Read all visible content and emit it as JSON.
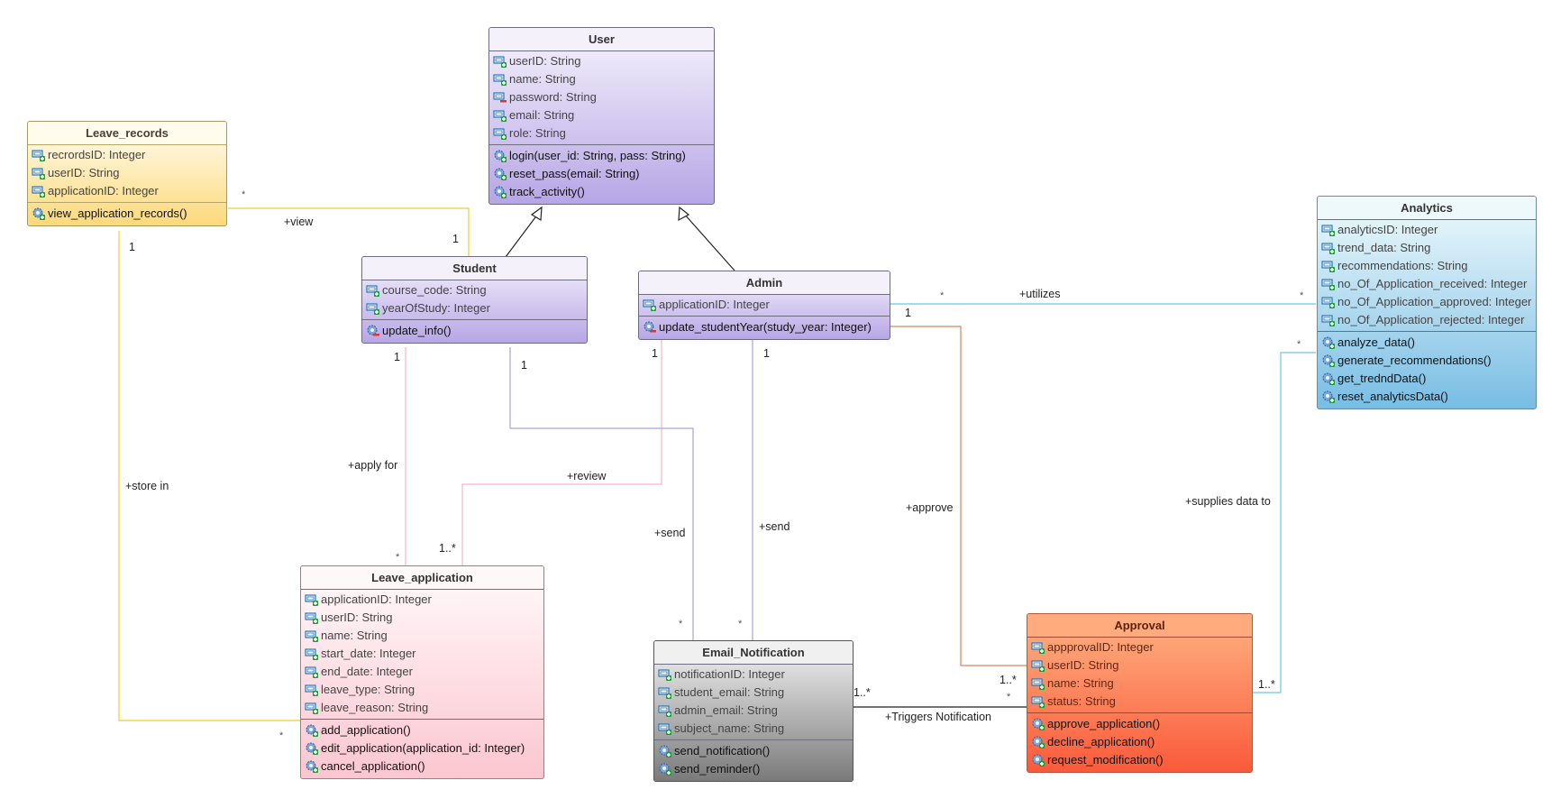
{
  "classes": {
    "user": {
      "name": "User",
      "attributes": [
        {
          "text": "userID: String",
          "visibility": "public"
        },
        {
          "text": "name: String",
          "visibility": "public"
        },
        {
          "text": "password: String",
          "visibility": "private"
        },
        {
          "text": "email: String",
          "visibility": "public"
        },
        {
          "text": "role: String",
          "visibility": "public"
        }
      ],
      "operations": [
        {
          "text": "login(user_id: String, pass: String)",
          "visibility": "public"
        },
        {
          "text": "reset_pass(email: String)",
          "visibility": "public"
        },
        {
          "text": "track_activity()",
          "visibility": "public"
        }
      ]
    },
    "leave_records": {
      "name": "Leave_records",
      "attributes": [
        {
          "text": "recrordsID: Integer",
          "visibility": "public"
        },
        {
          "text": "userID: String",
          "visibility": "public"
        },
        {
          "text": "applicationID: Integer",
          "visibility": "public"
        }
      ],
      "operations": [
        {
          "text": "view_application_records()",
          "visibility": "public"
        }
      ]
    },
    "student": {
      "name": "Student",
      "attributes": [
        {
          "text": "course_code: String",
          "visibility": "public"
        },
        {
          "text": "yearOfStudy: Integer",
          "visibility": "public"
        }
      ],
      "operations": [
        {
          "text": "update_info()",
          "visibility": "private"
        }
      ]
    },
    "admin": {
      "name": "Admin",
      "attributes": [
        {
          "text": "applicationID: Integer",
          "visibility": "public"
        }
      ],
      "operations": [
        {
          "text": "update_studentYear(study_year: Integer)",
          "visibility": "private"
        }
      ]
    },
    "analytics": {
      "name": "Analytics",
      "attributes": [
        {
          "text": "analyticsID: Integer",
          "visibility": "public"
        },
        {
          "text": "trend_data: String",
          "visibility": "public"
        },
        {
          "text": "recommendations: String",
          "visibility": "public"
        },
        {
          "text": "no_Of_Application_received: Integer",
          "visibility": "public"
        },
        {
          "text": "no_Of_Application_approved: Integer",
          "visibility": "public"
        },
        {
          "text": "no_Of_Application_rejected: Integer",
          "visibility": "public"
        }
      ],
      "operations": [
        {
          "text": "analyze_data()",
          "visibility": "public"
        },
        {
          "text": "generate_recommendations()",
          "visibility": "public"
        },
        {
          "text": "get_tredndData()",
          "visibility": "public"
        },
        {
          "text": "reset_analyticsData()",
          "visibility": "public"
        }
      ]
    },
    "leave_application": {
      "name": "Leave_application",
      "attributes": [
        {
          "text": "applicationID: Integer",
          "visibility": "public"
        },
        {
          "text": "userID: String",
          "visibility": "public"
        },
        {
          "text": "name: String",
          "visibility": "public"
        },
        {
          "text": "start_date: Integer",
          "visibility": "public"
        },
        {
          "text": "end_date: Integer",
          "visibility": "public"
        },
        {
          "text": "leave_type: String",
          "visibility": "public"
        },
        {
          "text": "leave_reason: String",
          "visibility": "public"
        }
      ],
      "operations": [
        {
          "text": "add_application()",
          "visibility": "public"
        },
        {
          "text": "edit_application(application_id: Integer)",
          "visibility": "public"
        },
        {
          "text": "cancel_application()",
          "visibility": "public"
        }
      ]
    },
    "email_notification": {
      "name": "Email_Notification",
      "attributes": [
        {
          "text": "notificationID: Integer",
          "visibility": "public"
        },
        {
          "text": "student_email: String",
          "visibility": "public"
        },
        {
          "text": "admin_email: String",
          "visibility": "public"
        },
        {
          "text": "subject_name: String",
          "visibility": "public"
        }
      ],
      "operations": [
        {
          "text": "send_notification()",
          "visibility": "public"
        },
        {
          "text": "send_reminder()",
          "visibility": "public"
        }
      ]
    },
    "approval": {
      "name": "Approval",
      "attributes": [
        {
          "text": "appprovalID: Integer",
          "visibility": "public"
        },
        {
          "text": "userID: String",
          "visibility": "public"
        },
        {
          "text": "name: String",
          "visibility": "public"
        },
        {
          "text": "status: String",
          "visibility": "public"
        }
      ],
      "operations": [
        {
          "text": "approve_application()",
          "visibility": "public"
        },
        {
          "text": "decline_application()",
          "visibility": "public"
        },
        {
          "text": "request_modification()",
          "visibility": "public"
        }
      ]
    }
  },
  "relationships": [
    {
      "id": "gen-student-user",
      "type": "generalization",
      "from": "Student",
      "to": "User"
    },
    {
      "id": "gen-admin-user",
      "type": "generalization",
      "from": "Admin",
      "to": "User"
    },
    {
      "id": "assoc-view",
      "type": "association",
      "label": "+view",
      "from": "Leave_records",
      "to": "Student",
      "mult_from": "*",
      "mult_to": "1",
      "color": "#f0d020"
    },
    {
      "id": "assoc-store",
      "type": "association",
      "label": "+store in",
      "from": "Leave_records",
      "to": "Leave_application",
      "mult_from": "1",
      "mult_to": "*",
      "color": "#f0d020"
    },
    {
      "id": "assoc-apply",
      "type": "association",
      "label": "+apply for",
      "from": "Student",
      "to": "Leave_application",
      "mult_from": "1",
      "mult_to": "*",
      "color": "#f2b8c6"
    },
    {
      "id": "assoc-review",
      "type": "association",
      "label": "+review",
      "from": "Admin",
      "to": "Leave_application",
      "mult_from": "1",
      "mult_to": "1..*",
      "color": "#f2b8c6"
    },
    {
      "id": "assoc-send-student",
      "type": "association",
      "label": "+send",
      "from": "Student",
      "to": "Email_Notification",
      "mult_from": "1",
      "mult_to": "*",
      "color": "#a9a3d6"
    },
    {
      "id": "assoc-send-admin",
      "type": "association",
      "label": "+send",
      "from": "Admin",
      "to": "Email_Notification",
      "mult_from": "1",
      "mult_to": "*",
      "color": "#a9a3d6"
    },
    {
      "id": "assoc-utilizes",
      "type": "association",
      "label": "+utilizes",
      "from": "Admin",
      "to": "Analytics",
      "mult_from": "*",
      "mult_to": "*",
      "color": "#6cc6e0"
    },
    {
      "id": "assoc-approve",
      "type": "association",
      "label": "+approve",
      "from": "Admin",
      "to": "Approval",
      "mult_from": "1",
      "mult_to": "1..*",
      "color": "#e0805a"
    },
    {
      "id": "assoc-supplies",
      "type": "association",
      "label": "+supplies data to",
      "from": "Approval",
      "to": "Analytics",
      "mult_from": "1..*",
      "mult_to": "*",
      "color": "#6cc6e0"
    },
    {
      "id": "assoc-triggers",
      "type": "association",
      "label": "+Triggers Notification",
      "from": "Email_Notification",
      "to": "Approval",
      "mult_from": "1..*",
      "mult_to": "*",
      "color": "#222222"
    }
  ],
  "labels": {
    "view": "+view",
    "store_in": "+store in",
    "apply_for": "+apply for",
    "review": "+review",
    "send_student": "+send",
    "send_admin": "+send",
    "utilizes": "+utilizes",
    "approve": "+approve",
    "supplies": "+supplies data to",
    "triggers": "+Triggers Notification"
  },
  "multiplicities": {
    "view_records": "*",
    "view_student": "1",
    "store_records": "1",
    "store_app": "*",
    "apply_student": "1",
    "apply_app": "*",
    "review_admin": "1",
    "review_app": "1..*",
    "send_student": "1",
    "send_student_email": "*",
    "send_admin": "1",
    "send_admin_email": "*",
    "utilizes_admin": "*",
    "utilizes_admin_1": "1",
    "utilizes_analytics": "*",
    "supplies_analytics": "*",
    "supplies_approval": "1..*",
    "approve_approval": "1..*",
    "triggers_email": "1..*",
    "triggers_approval": "*"
  }
}
